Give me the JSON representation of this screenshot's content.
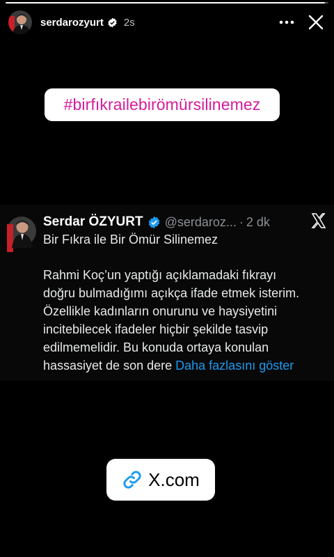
{
  "story": {
    "progress_fraction": 0.99,
    "username": "serdarozyurt",
    "time": "2s"
  },
  "hashtag": {
    "text": "#birfıkrailebirömürsilinemez",
    "color": "#D31C9C"
  },
  "tweet": {
    "name": "Serdar ÖZYURT",
    "handle": "@serdaroz...",
    "dot": "·",
    "time": "2 dk",
    "title": "Bir Fıkra ile Bir Ömür Silinemez",
    "body_lines": [
      "Rahmi Koç’un yaptığı açıklamadaki fıkrayı",
      "doğru bulmadığımı açıkça ifade etmek isterim.",
      "Özellikle kadınların onurunu ve haysiyetini",
      "incitebilecek ifadeler hiçbir şekilde tasvip",
      "edilmemelidir. Bu konuda ortaya konulan",
      "hassasiyet de son dere"
    ],
    "show_more": "Daha fazlasını göster",
    "link_color": "#1d9bf0"
  },
  "link_sticker": {
    "text": "X.com",
    "icon_color": "#1d9bf0"
  },
  "icons": {
    "more": "more-options-icon",
    "close": "close-icon",
    "verified": "verified-badge-icon",
    "x_logo": "x-logo-icon",
    "link": "link-icon"
  }
}
